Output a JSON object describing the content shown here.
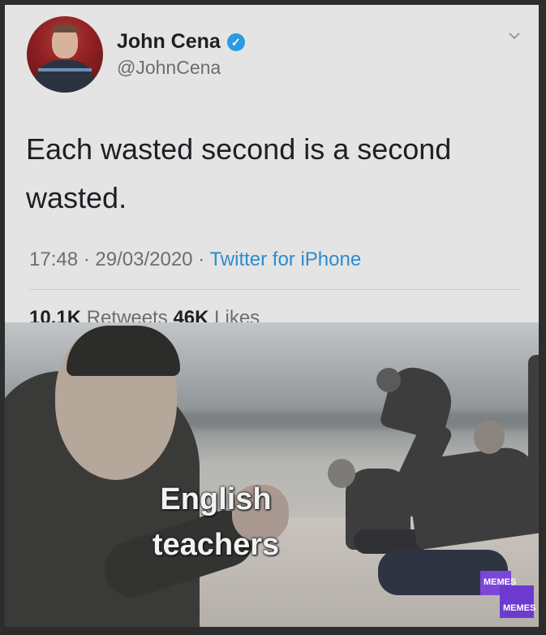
{
  "tweet": {
    "name": "John Cena",
    "handle": "@JohnCena",
    "text": "Each wasted second is a second wasted.",
    "time": "17:48",
    "date": "29/03/2020",
    "source": "Twitter for iPhone",
    "separator": "·",
    "retweets_count": "10.1K",
    "retweets_label": "Retweets",
    "likes_count": "46K",
    "likes_label": "Likes"
  },
  "meme": {
    "caption_line1": "English",
    "caption_line2": "teachers",
    "watermark_line1": "MEMES",
    "watermark_line2": "MEMES"
  },
  "icons": {
    "verified": "verified-badge-icon",
    "menu": "chevron-down-icon"
  },
  "colors": {
    "verified": "#2b9ae0",
    "link": "#2b8bd0",
    "card_bg": "#e4e4e4",
    "watermark": "#7b47d9"
  }
}
